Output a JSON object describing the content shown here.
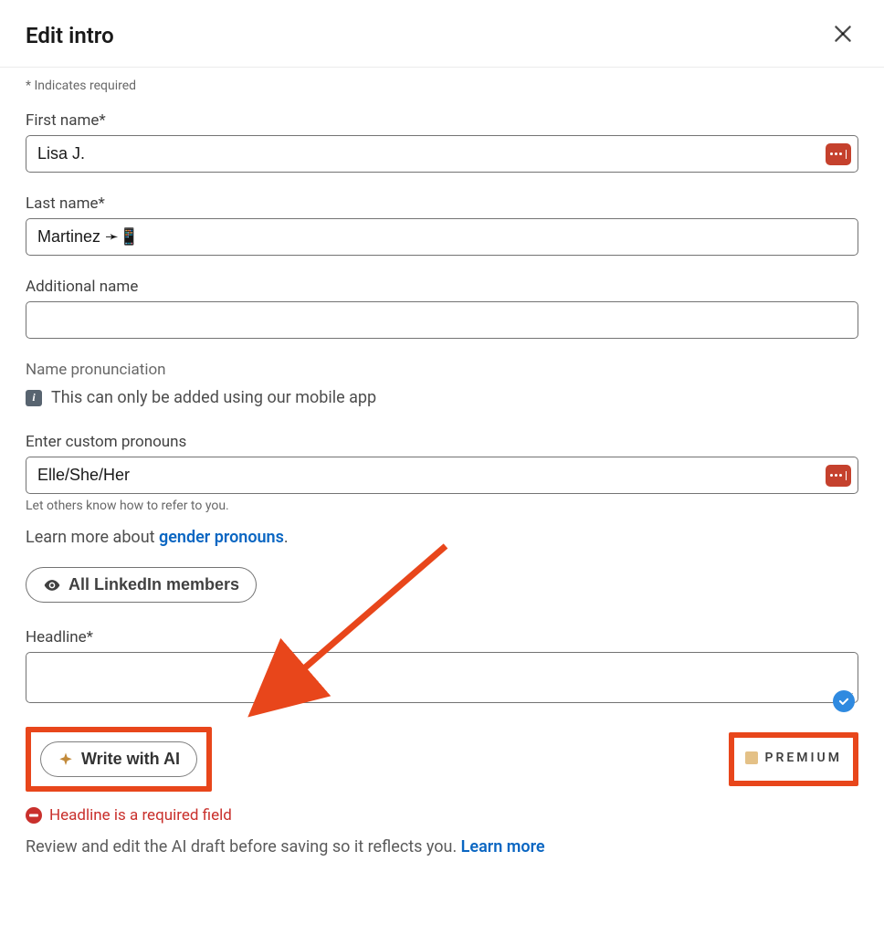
{
  "modal": {
    "title": "Edit intro",
    "required_note": "* Indicates required"
  },
  "first_name": {
    "label": "First name*",
    "value": "Lisa J."
  },
  "last_name": {
    "label": "Last name*",
    "value": "Martinez ➛📱"
  },
  "additional_name": {
    "label": "Additional name",
    "value": ""
  },
  "pronunciation": {
    "label": "Name pronunciation",
    "info": "This can only be added using our mobile app"
  },
  "pronouns": {
    "label": "Enter custom pronouns",
    "value": "Elle/She/Her",
    "hint": "Let others know how to refer to you.",
    "learn_prefix": "Learn more about ",
    "learn_link": "gender pronouns",
    "learn_suffix": "."
  },
  "visibility": {
    "button_label": "All LinkedIn members"
  },
  "headline": {
    "label": "Headline*",
    "value": "",
    "ai_button": "Write with AI",
    "premium_label": "PREMIUM",
    "error": "Headline is a required field",
    "review_prefix": "Review and edit the AI draft before saving so it reflects you. ",
    "review_link": "Learn more"
  }
}
